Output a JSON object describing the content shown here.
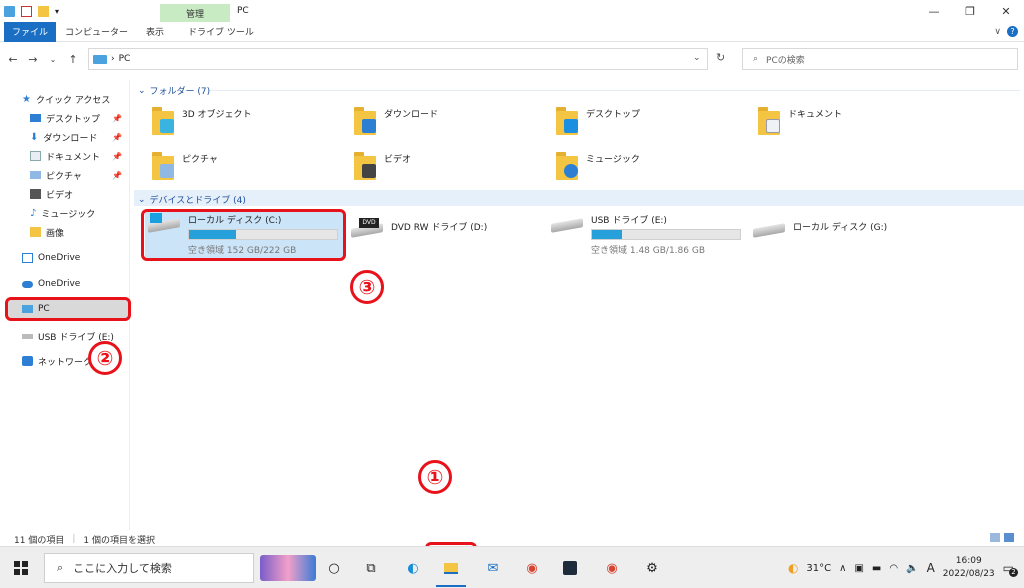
{
  "titlebar": {
    "context_tab": "管理",
    "title": "PC"
  },
  "ribbon": {
    "tabs": [
      "ファイル",
      "コンピューター",
      "表示",
      "ドライブ ツール"
    ]
  },
  "address": {
    "path": "PC",
    "search_placeholder": "PCの検索"
  },
  "sidebar": {
    "quick_access": "クイック アクセス",
    "items": [
      {
        "label": "デスクトップ",
        "pinned": true
      },
      {
        "label": "ダウンロード",
        "pinned": true
      },
      {
        "label": "ドキュメント",
        "pinned": true
      },
      {
        "label": "ピクチャ",
        "pinned": true
      },
      {
        "label": "ビデオ",
        "pinned": false
      },
      {
        "label": "ミュージック",
        "pinned": false
      },
      {
        "label": "画像",
        "pinned": false
      }
    ],
    "onedrive1": "OneDrive",
    "onedrive2": "OneDrive",
    "pc": "PC",
    "usb": "USB ドライブ (E:)",
    "network": "ネットワーク"
  },
  "main": {
    "folders_header": "フォルダー (7)",
    "folders": [
      "3D オブジェクト",
      "ダウンロード",
      "デスクトップ",
      "ドキュメント",
      "ピクチャ",
      "ビデオ",
      "ミュージック"
    ],
    "devices_header": "デバイスとドライブ (4)",
    "drives": [
      {
        "name": "ローカル ディスク (C:)",
        "free_text": "空き領域 152 GB/222 GB",
        "used_fraction": 0.32
      },
      {
        "name": "DVD RW ドライブ (D:)"
      },
      {
        "name": "USB ドライブ (E:)",
        "free_text": "空き領域 1.48 GB/1.86 GB",
        "used_fraction": 0.2
      },
      {
        "name": "ローカル ディスク (G:)"
      }
    ]
  },
  "annotations": {
    "c1": "①",
    "c2": "②",
    "c3": "③"
  },
  "status": {
    "count": "11 個の項目",
    "selected": "1 個の項目を選択"
  },
  "taskbar": {
    "search_placeholder": "ここに入力して検索",
    "temp": "31°C",
    "ime": "A",
    "time": "16:09",
    "date": "2022/08/23",
    "notif_count": "2"
  },
  "colors": {
    "accent": "#1a6fc4",
    "highlight": "#e8121b",
    "folder": "#f4c542",
    "selection": "#cce4f7"
  }
}
